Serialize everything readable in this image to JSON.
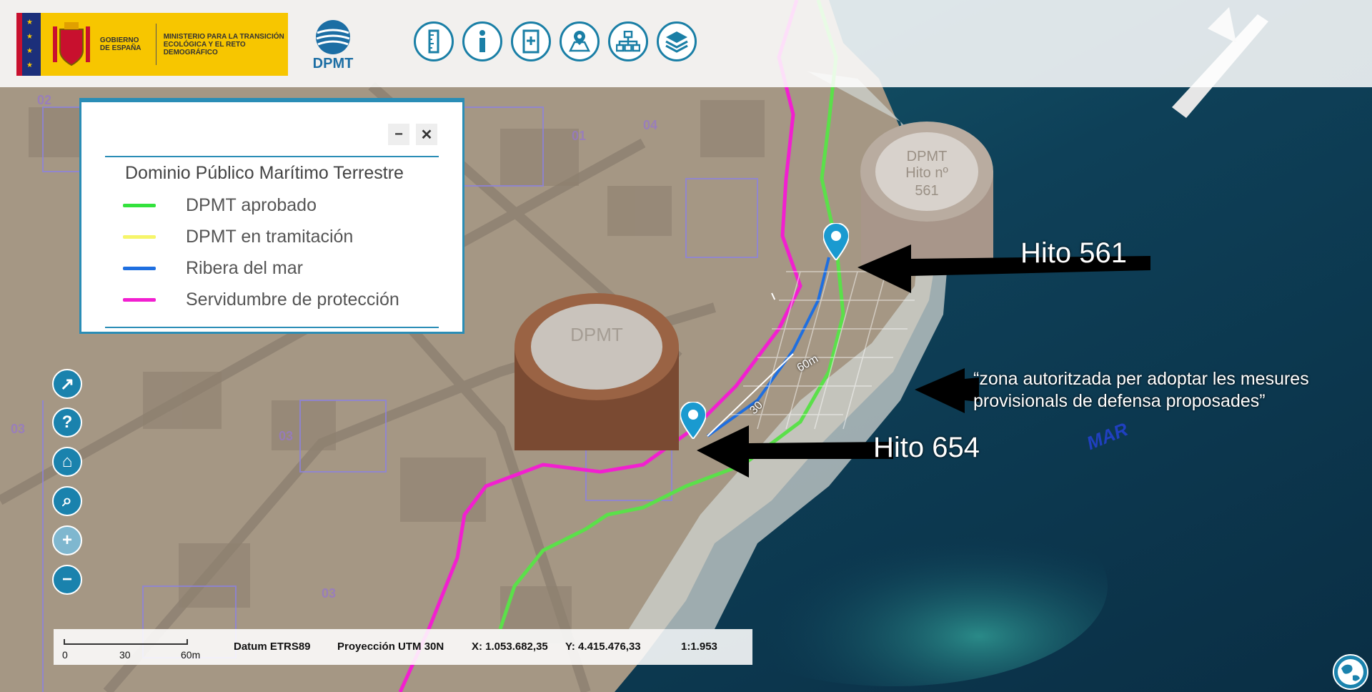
{
  "header": {
    "gov_name": "Gobierno de España",
    "ministry": "Ministerio para la Transición Ecológica y el Reto Demográfico",
    "app_logo": "DPMT"
  },
  "toolbar": {
    "buttons": [
      {
        "icon": "ruler-icon"
      },
      {
        "icon": "info-icon"
      },
      {
        "icon": "bookmark-add-icon"
      },
      {
        "icon": "map-pin-icon"
      },
      {
        "icon": "hierarchy-icon"
      },
      {
        "icon": "layers-icon"
      }
    ]
  },
  "legend": {
    "title": "Dominio Público Marítimo Terrestre",
    "items": [
      {
        "label": "DPMT aprobado",
        "color": "#33e23c"
      },
      {
        "label": "DPMT en tramitación",
        "color": "#f6f56a"
      },
      {
        "label": "Ribera del mar",
        "color": "#1f6fe0"
      },
      {
        "label": "Servidumbre de protección",
        "color": "#f21fd0"
      }
    ],
    "minimize": "−",
    "close": "✕"
  },
  "side_tools": [
    {
      "icon": "share-icon",
      "glyph": "↗"
    },
    {
      "icon": "help-icon",
      "glyph": "?"
    },
    {
      "icon": "home-icon",
      "glyph": "⌂"
    },
    {
      "icon": "zoom-search-icon",
      "glyph": "⌕"
    },
    {
      "icon": "zoom-in-icon",
      "glyph": "+"
    },
    {
      "icon": "zoom-out-icon",
      "glyph": "−"
    }
  ],
  "status": {
    "scale_ticks": [
      "0",
      "30",
      "60m"
    ],
    "datum": "Datum ETRS89",
    "projection": "Proyección UTM 30N",
    "x": "X: 1.053.682,35",
    "y": "Y: 4.415.476,33",
    "scale": "1:1.953"
  },
  "annotations": {
    "hito_561": "Hito 561",
    "hito_654": "Hito 654",
    "quote_line1": "“zona autoritzada per adoptar les mesures",
    "quote_line2": "provisionals de defensa proposades”",
    "map_label": "MAR",
    "measure_label": "60m",
    "measure_mid": "30"
  },
  "colors": {
    "accent": "#1a82ad",
    "sea": "#0d3b4f",
    "urban": "#b9a995"
  }
}
